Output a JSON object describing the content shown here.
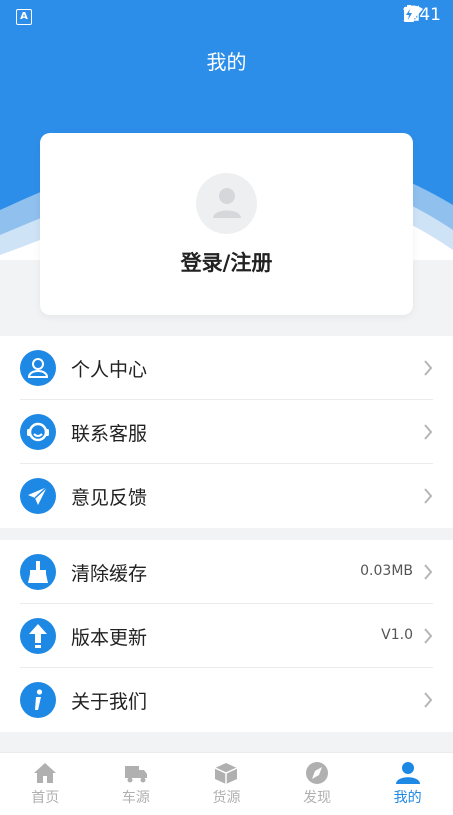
{
  "status_bar": {
    "time": "2:41",
    "left_badge": "A"
  },
  "header": {
    "title": "我的"
  },
  "login_card": {
    "text": "登录/注册"
  },
  "menu_group_1": [
    {
      "label": "个人中心",
      "icon": "user-icon"
    },
    {
      "label": "联系客服",
      "icon": "headset-icon"
    },
    {
      "label": "意见反馈",
      "icon": "paper-plane-icon"
    }
  ],
  "menu_group_2": [
    {
      "label": "清除缓存",
      "value": "0.03MB",
      "icon": "broom-icon"
    },
    {
      "label": "版本更新",
      "value": "V1.0",
      "icon": "upload-arrow-icon"
    },
    {
      "label": "关于我们",
      "icon": "info-icon"
    }
  ],
  "tabs": [
    {
      "label": "首页",
      "icon": "home-icon"
    },
    {
      "label": "车源",
      "icon": "truck-icon"
    },
    {
      "label": "货源",
      "icon": "box-icon"
    },
    {
      "label": "发现",
      "icon": "compass-icon"
    },
    {
      "label": "我的",
      "icon": "person-icon",
      "active": true
    }
  ],
  "colors": {
    "primary": "#1e88e5",
    "header": "#2d8ee9"
  }
}
